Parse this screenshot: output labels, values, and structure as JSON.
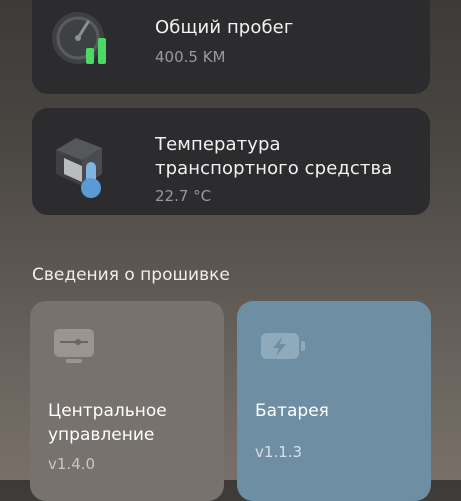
{
  "cards": {
    "mileage": {
      "title": "Общий пробег",
      "value": "400.5 KM",
      "icon": "speedometer-gauge-icon"
    },
    "temperature": {
      "title": "Температура транспортного средства",
      "value": "22.7 °C",
      "icon": "vehicle-thermometer-icon"
    }
  },
  "firmware": {
    "section_title": "Сведения о прошивке",
    "tiles": [
      {
        "title": "Центральное управление",
        "version": "v1.4.0",
        "icon": "controller-board-icon"
      },
      {
        "title": "Батарея",
        "version": "v1.1.3",
        "icon": "battery-charging-icon"
      }
    ]
  },
  "colors": {
    "card_bg": "#2c2c2e",
    "gauge_green": "#4cd964",
    "thermo_blue": "#5b9bd5",
    "tile_gray": "#77726d",
    "tile_blue": "#6e8ea3"
  }
}
